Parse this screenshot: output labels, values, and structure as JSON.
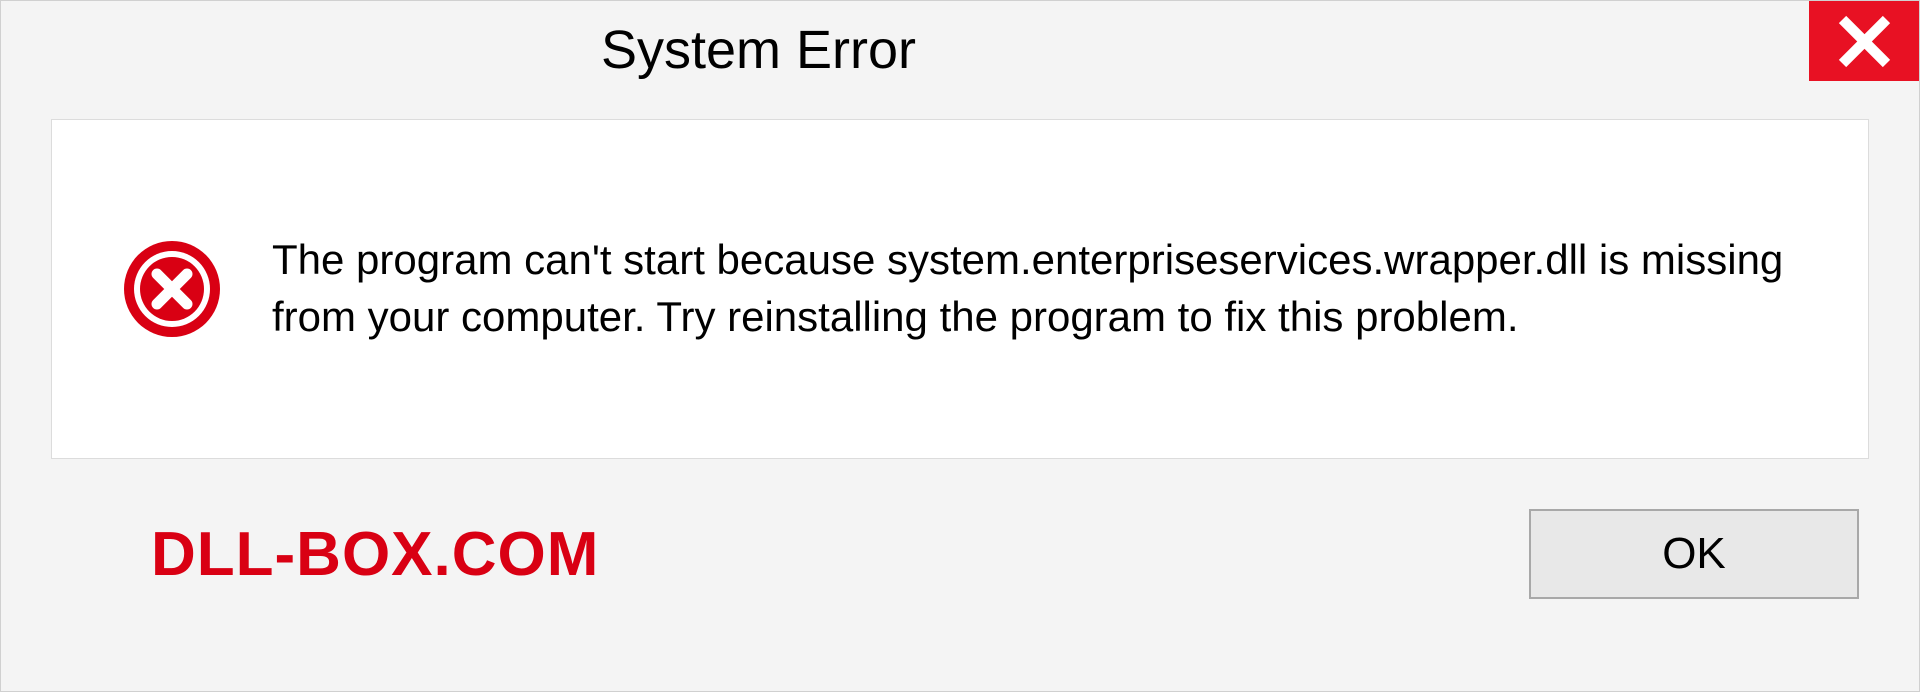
{
  "dialog": {
    "title": "System Error",
    "message": "The program can't start because system.enterpriseservices.wrapper.dll is missing from your computer. Try reinstalling the program to fix this problem.",
    "ok_label": "OK"
  },
  "watermark": "DLL-BOX.COM"
}
